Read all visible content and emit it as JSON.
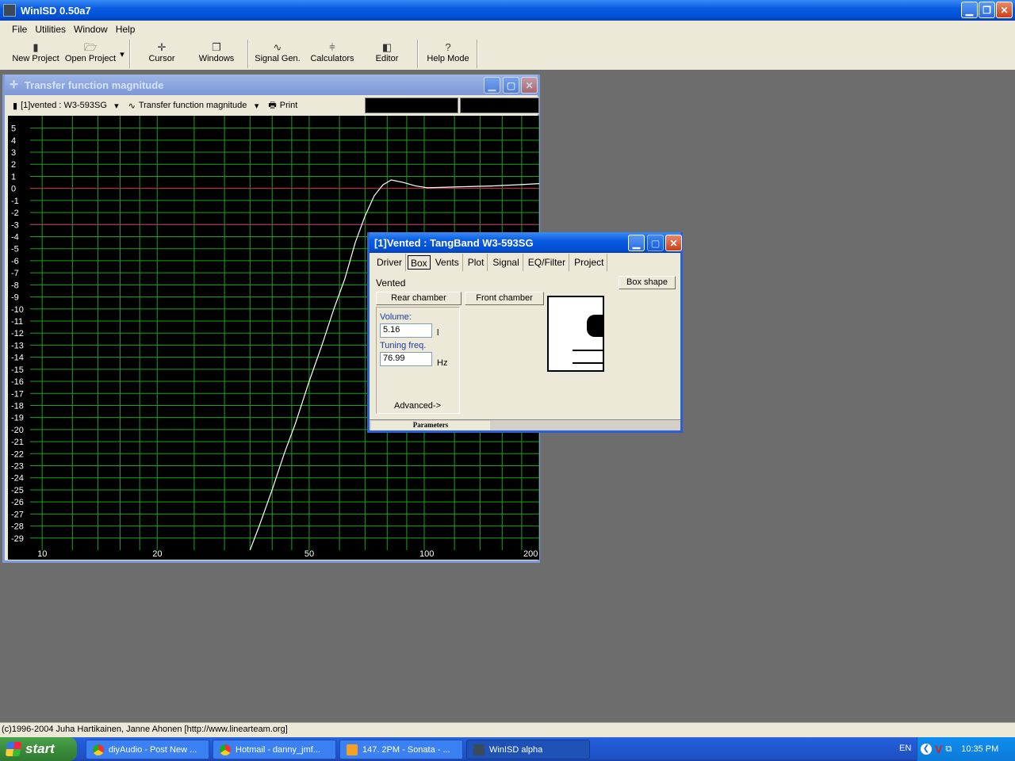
{
  "app": {
    "title": "WinISD 0.50a7",
    "menu": [
      "File",
      "Utilities",
      "Window",
      "Help"
    ],
    "toolbar": {
      "new_project": "New Project",
      "open_project": "Open Project",
      "cursor": "Cursor",
      "windows": "Windows",
      "signal_gen": "Signal Gen.",
      "calculators": "Calculators",
      "editor": "Editor",
      "help_mode": "Help Mode"
    },
    "status": "(c)1996-2004 Juha Hartikainen, Janne Ahonen [http://www.linearteam.org]"
  },
  "chart_window": {
    "title": "Transfer function magnitude",
    "project_select": "[1]vented : W3-593SG",
    "graph_select": "Transfer function magnitude",
    "print_label": "Print"
  },
  "chart_data": {
    "type": "line",
    "title": "",
    "xlabel": "",
    "ylabel": "",
    "x_scale": "log",
    "xlim": [
      9.3,
      200
    ],
    "ylim": [
      -30,
      5.5
    ],
    "x_tick_labels": [
      {
        "label": "10",
        "value": 10
      },
      {
        "label": "20",
        "value": 20
      },
      {
        "label": "50",
        "value": 50
      },
      {
        "label": "100",
        "value": 100
      },
      {
        "label": "200",
        "value": 200
      }
    ],
    "y_ticks": [
      5,
      4,
      3,
      2,
      1,
      0,
      -1,
      -2,
      -3,
      -4,
      -5,
      -6,
      -7,
      -8,
      -9,
      -10,
      -11,
      -12,
      -13,
      -14,
      -15,
      -16,
      -17,
      -18,
      -19,
      -20,
      -21,
      -22,
      -23,
      -24,
      -25,
      -26,
      -27,
      -28,
      -29
    ],
    "x_grid": [
      10,
      12,
      14,
      16,
      18,
      20,
      25,
      30,
      35,
      40,
      45,
      50,
      60,
      70,
      80,
      90,
      100,
      120,
      140,
      160,
      180,
      200
    ],
    "reference_lines": [
      {
        "y": 0,
        "color": "#d02040"
      },
      {
        "y": -3,
        "color": "#c02a78"
      }
    ],
    "grid": true,
    "grid_color": "#19a519",
    "series": [
      {
        "color": "#ffffff",
        "x": [
          35,
          37,
          40,
          43,
          46,
          50,
          54,
          58,
          62,
          66,
          70,
          74,
          78,
          82,
          88,
          95,
          102,
          115,
          130,
          150,
          175,
          200
        ],
        "y": [
          -30,
          -28,
          -25,
          -22,
          -19.5,
          -16,
          -13,
          -10,
          -7.5,
          -4.5,
          -2.3,
          -0.6,
          0.3,
          0.7,
          0.5,
          0.2,
          0.05,
          0.1,
          0.15,
          0.2,
          0.3,
          0.4
        ]
      }
    ]
  },
  "param_window": {
    "title": "[1]Vented : TangBand W3-593SG",
    "tabs": [
      "Driver",
      "Box",
      "Vents",
      "Plot",
      "Signal",
      "EQ/Filter",
      "Project"
    ],
    "selected_tab": "Box",
    "box_type": "Vented",
    "box_shape_button": "Box shape",
    "rear_chamber_button": "Rear chamber",
    "front_chamber_button": "Front chamber",
    "volume_label": "Volume:",
    "volume_value": "5.16",
    "volume_unit": "l",
    "tuning_label": "Tuning freq.",
    "tuning_value": "76.99",
    "tuning_unit": "Hz",
    "advanced_label": "Advanced->",
    "params_tab_label": "Parameters"
  },
  "taskbar": {
    "start_label": "start",
    "tasks": [
      "diyAudio - Post New ...",
      "Hotmail - danny_jmf...",
      "147. 2PM - Sonata - ...",
      "WinISD alpha"
    ],
    "language": "EN",
    "clock": "10:35 PM"
  }
}
